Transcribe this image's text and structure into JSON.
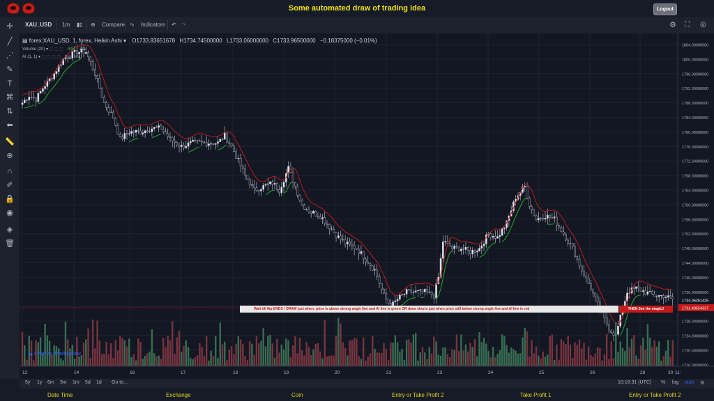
{
  "header": {
    "title": "Some automated draw of trading idea",
    "logout_label": "Logout"
  },
  "toolbar": {
    "symbol": "XAU_USD",
    "interval": "1m",
    "compare": "Compare",
    "indicators": "Indicators"
  },
  "legend": {
    "instrument": "forex:XAU_USD, 1, forex, Heikin Ashi",
    "open": "O1733.83651678",
    "high": "H1734.74500000",
    "low": "L1733.06000000",
    "close": "C1733.96500000",
    "change": "−0.18375000 (−0.01%)",
    "volume_label": "Volume (20)",
    "volume_value": "905",
    "volume_na": "n/a",
    "ai_label": "AI (1, 1)",
    "ai_na1": "n/a",
    "ai_na2": "n/a"
  },
  "price_axis": {
    "labels": [
      "1804.00000000",
      "1800.00000000",
      "1796.00000000",
      "1792.00000000",
      "1788.00000000",
      "1784.00000000",
      "1780.00000000",
      "1776.00000000",
      "1772.00000000",
      "1768.00000000",
      "1764.00000000",
      "1760.00000000",
      "1756.00000000",
      "1752.00000000",
      "1748.00000000",
      "1744.00000000",
      "1740.00000000",
      "1736.00000000",
      "1732.00000000",
      "1728.00000000",
      "1724.00000000",
      "1720.00000000",
      "1716.00000000"
    ],
    "current_price_tag": "1734.06261425",
    "line_price_tag": "1731.48554337"
  },
  "time_axis": {
    "labels": [
      "12",
      "14",
      "16",
      "17",
      "18",
      "19",
      "20",
      "21",
      "23",
      "24",
      "25",
      "26",
      "28",
      "30",
      "11:"
    ]
  },
  "annotation": {
    "text": "Wait till flip ENDS  !   DRAW just when:  price is above strong angle line and AI line is green        OR        draw shorts just when price still below strong angle line and AI line is red",
    "cta": "THEN See the magic!!"
  },
  "watermark": "Chart by TradingView",
  "bottombar": {
    "ranges": [
      "5y",
      "1y",
      "6m",
      "3m",
      "1m",
      "5d",
      "1d"
    ],
    "goto": "Go to...",
    "time": "10:16:31 (UTC)",
    "percent": "%",
    "log": "log",
    "auto": "auto"
  },
  "footer": {
    "cols": [
      "Date Time",
      "Exchange",
      "Coin",
      "Entry or Take Profit 2",
      "Take Profit 1",
      "Entry or Take Profit 2"
    ]
  },
  "colors": {
    "up": "#e0e3eb",
    "down": "#131722",
    "ai_up": "#1f9d2c",
    "ai_down": "#b31f1f",
    "vol_up": "#3f7d5c",
    "vol_down": "#8a3a44",
    "accent": "#f2e21a"
  },
  "chart_data": {
    "type": "candlestick",
    "ylim": [
      1716,
      1806
    ],
    "series": [
      {
        "name": "Heikin Ashi",
        "anchors": [
          [
            0,
            1788
          ],
          [
            3,
            1790
          ],
          [
            6,
            1789
          ],
          [
            9,
            1792
          ],
          [
            14,
            1796
          ],
          [
            18,
            1800
          ],
          [
            24,
            1802
          ],
          [
            28,
            1802
          ],
          [
            32,
            1796
          ],
          [
            36,
            1788
          ],
          [
            40,
            1784
          ],
          [
            43,
            1778
          ],
          [
            47,
            1780
          ],
          [
            52,
            1780
          ],
          [
            57,
            1781
          ],
          [
            61,
            1781
          ],
          [
            65,
            1778
          ],
          [
            70,
            1776
          ],
          [
            75,
            1777
          ],
          [
            81,
            1777
          ],
          [
            86,
            1777
          ],
          [
            89,
            1779
          ],
          [
            92,
            1776
          ],
          [
            95,
            1772
          ],
          [
            98,
            1768
          ],
          [
            102,
            1764
          ],
          [
            106,
            1765
          ],
          [
            110,
            1766
          ],
          [
            113,
            1764
          ],
          [
            117,
            1770
          ],
          [
            120,
            1765
          ],
          [
            123,
            1760
          ],
          [
            127,
            1758
          ],
          [
            131,
            1757
          ],
          [
            135,
            1754
          ],
          [
            139,
            1751
          ],
          [
            143,
            1749
          ],
          [
            147,
            1748
          ],
          [
            151,
            1745
          ],
          [
            155,
            1742
          ],
          [
            159,
            1735
          ],
          [
            162,
            1732
          ],
          [
            165,
            1734
          ],
          [
            169,
            1736
          ],
          [
            173,
            1736
          ],
          [
            177,
            1736
          ],
          [
            181,
            1735
          ],
          [
            183,
            1740
          ],
          [
            185,
            1750
          ],
          [
            189,
            1748
          ],
          [
            193,
            1748
          ],
          [
            197,
            1747
          ],
          [
            201,
            1748
          ],
          [
            205,
            1752
          ],
          [
            209,
            1751
          ],
          [
            213,
            1755
          ],
          [
            217,
            1762
          ],
          [
            221,
            1765
          ],
          [
            223,
            1760
          ],
          [
            226,
            1756
          ],
          [
            230,
            1757
          ],
          [
            234,
            1756
          ],
          [
            238,
            1752
          ],
          [
            242,
            1748
          ],
          [
            246,
            1742
          ],
          [
            250,
            1737
          ],
          [
            254,
            1731
          ],
          [
            258,
            1726
          ],
          [
            261,
            1724
          ],
          [
            263,
            1729
          ],
          [
            266,
            1736
          ],
          [
            270,
            1737
          ],
          [
            274,
            1736
          ],
          [
            278,
            1735
          ],
          [
            282,
            1735
          ],
          [
            286,
            1734
          ]
        ]
      },
      {
        "name": "Volume"
      }
    ]
  }
}
